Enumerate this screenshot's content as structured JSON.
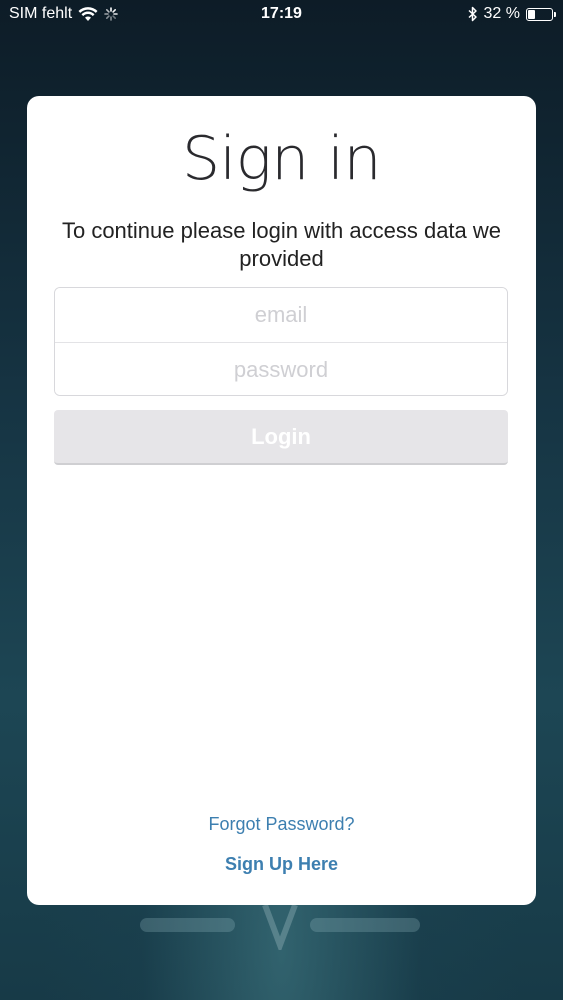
{
  "status_bar": {
    "carrier": "SIM fehlt",
    "time": "17:19",
    "battery_text": "32 %",
    "battery_level": 0.32,
    "icons": [
      "wifi-icon",
      "activity-spinner-icon",
      "bluetooth-icon",
      "battery-icon"
    ]
  },
  "signin": {
    "title": "Sign in",
    "subtitle": "To continue please login with access data we provided",
    "email_placeholder": "email",
    "password_placeholder": "password",
    "login_label": "Login",
    "forgot_label": "Forgot Password?",
    "signup_label": "Sign Up Here"
  },
  "colors": {
    "link": "#3d7fb0",
    "button_disabled": "#e6e5e8",
    "background_dark": "#163443"
  }
}
